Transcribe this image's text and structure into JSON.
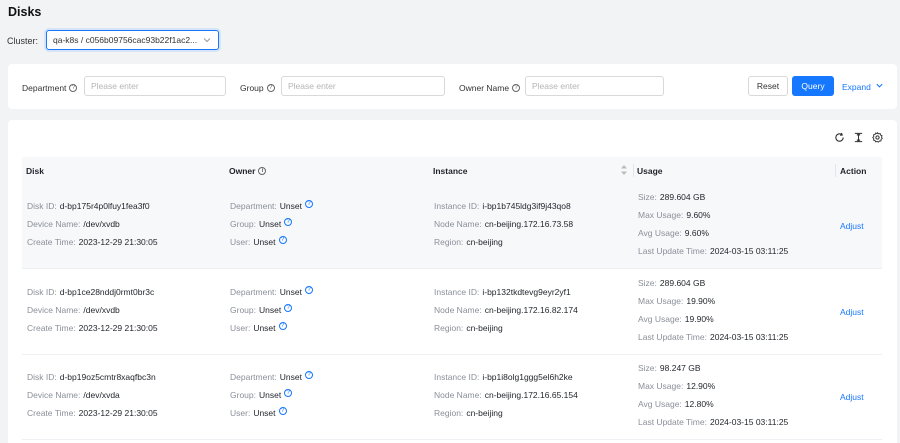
{
  "page": {
    "title": "Disks"
  },
  "cluster": {
    "label": "Cluster:",
    "value": "qa-k8s / c056b09756cac93b22f1ac2..."
  },
  "filters": {
    "department": {
      "label": "Department",
      "placeholder": "Please enter"
    },
    "group": {
      "label": "Group",
      "placeholder": "Please enter"
    },
    "owner_name": {
      "label": "Owner Name",
      "placeholder": "Please enter"
    },
    "reset_label": "Reset",
    "query_label": "Query",
    "expand_label": "Expand"
  },
  "table": {
    "headers": {
      "disk": "Disk",
      "owner": "Owner",
      "instance": "Instance",
      "usage": "Usage",
      "action": "Action"
    },
    "field_labels": {
      "disk_id": "Disk ID:",
      "device_name": "Device Name:",
      "create_time": "Create Time:",
      "department": "Department:",
      "group": "Group:",
      "user": "User:",
      "instance_id": "Instance ID:",
      "node_name": "Node Name:",
      "region": "Region:",
      "size": "Size:",
      "max_usage": "Max Usage:",
      "avg_usage": "Avg Usage:",
      "last_update": "Last Update Time:"
    },
    "rows": [
      {
        "disk_id": "d-bp175r4p0lfuy1fea3f0",
        "device_name": "/dev/xvdb",
        "create_time": "2023-12-29 21:30:05",
        "department": "Unset",
        "group": "Unset",
        "user": "Unset",
        "instance_id": "i-bp1b745ldg3if9j43qo8",
        "node_name": "cn-beijing.172.16.73.58",
        "region": "cn-beijing",
        "size": "289.604 GB",
        "max_usage": "9.60%",
        "avg_usage": "9.60%",
        "last_update": "2024-03-15 03:11:25",
        "action": "Adjust"
      },
      {
        "disk_id": "d-bp1ce28nddj0rmt0br3c",
        "device_name": "/dev/xvdb",
        "create_time": "2023-12-29 21:30:05",
        "department": "Unset",
        "group": "Unset",
        "user": "Unset",
        "instance_id": "i-bp132tkdtevg9eyr2yf1",
        "node_name": "cn-beijing.172.16.82.174",
        "region": "cn-beijing",
        "size": "289.604 GB",
        "max_usage": "19.90%",
        "avg_usage": "19.90%",
        "last_update": "2024-03-15 03:11:25",
        "action": "Adjust"
      },
      {
        "disk_id": "d-bp19oz5cmtr8xaqfbc3n",
        "device_name": "/dev/xvda",
        "create_time": "2023-12-29 21:30:05",
        "department": "Unset",
        "group": "Unset",
        "user": "Unset",
        "instance_id": "i-bp1i8olg1ggg5el6h2ke",
        "node_name": "cn-beijing.172.16.65.154",
        "region": "cn-beijing",
        "size": "98.247 GB",
        "max_usage": "12.90%",
        "avg_usage": "12.80%",
        "last_update": "2024-03-15 03:11:25",
        "action": "Adjust"
      }
    ]
  },
  "icons": [
    "question-circle-icon",
    "chevron-down-icon",
    "refresh-icon",
    "column-height-icon",
    "settings-gear-icon",
    "info-circle-icon",
    "sort-icon"
  ],
  "colors": {
    "primary": "#1677ff",
    "background": "#f2f3f5",
    "header_bg": "#f7f8fa"
  }
}
